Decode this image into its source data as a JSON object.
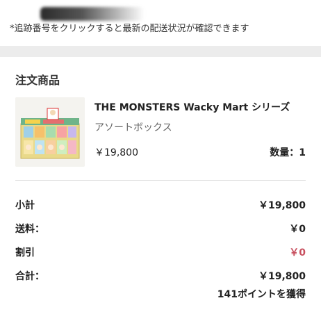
{
  "notice": {
    "text": "*追跡番号をクリックすると最新の配送状況が確認できます"
  },
  "order": {
    "section_title": "注文商品",
    "product": {
      "name": "THE MONSTERS Wacky Mart シリーズ",
      "variant": "アソートボックス",
      "price": "￥19,800",
      "quantity": "数量：1",
      "thumbnail_icon": "product-box-image"
    }
  },
  "summary": {
    "subtotal_label": "小計",
    "subtotal_value": "￥19,800",
    "shipping_label": "送料：",
    "shipping_value": "￥0",
    "discount_label": "割引",
    "discount_value": "￥0",
    "total_label": "合計：",
    "total_value": "￥19,800",
    "points_text": "141ポイントを獲得"
  },
  "colors": {
    "discount": "#c8505f",
    "background": "#f0f0f0",
    "card": "#ffffff"
  }
}
